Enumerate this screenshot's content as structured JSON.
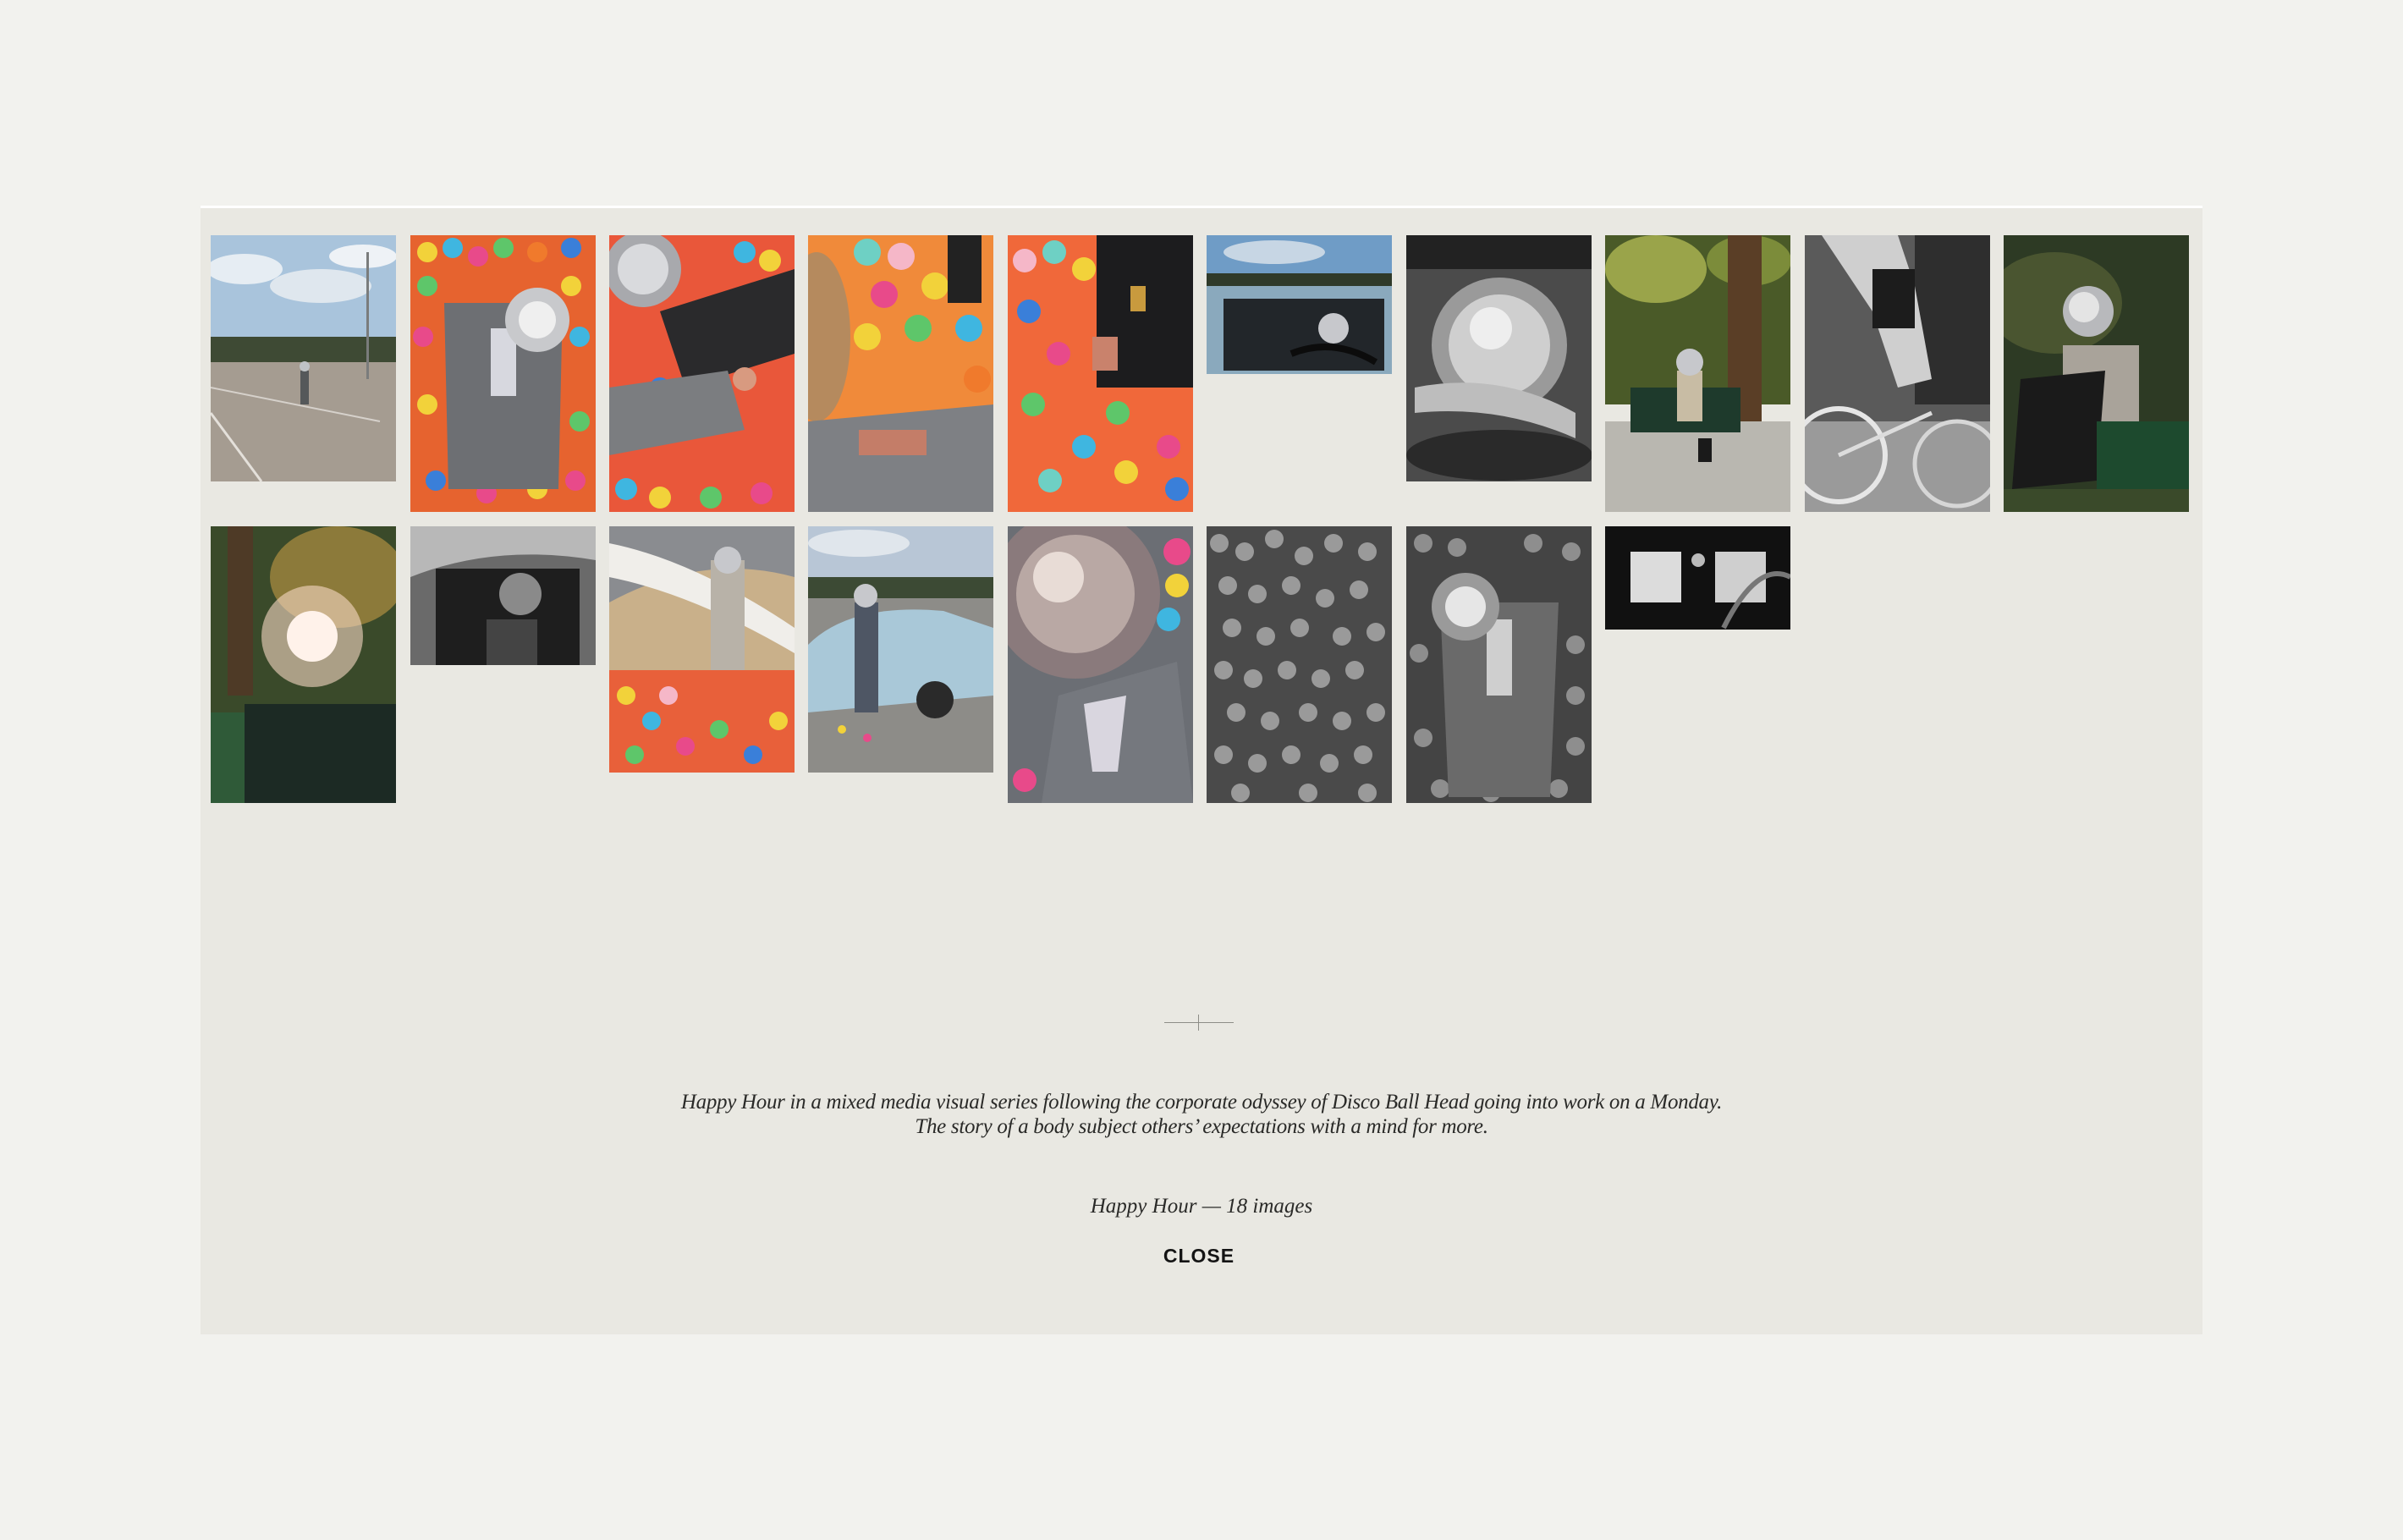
{
  "gallery": {
    "description_line1": "Happy Hour in a mixed media visual series following the corporate odyssey of Disco Ball Head going into work on a Monday.",
    "description_line2": "The story of a body subject others’ expectations with a mind for more.",
    "series_title": "Happy Hour",
    "separator": "—",
    "image_count_label": "18 images",
    "close_label": "CLOSE"
  },
  "colors": {
    "page_background": "#f2f2ee",
    "panel_background": "#e9e8e2",
    "text": "#2a2a28"
  },
  "thumbnails": [
    {
      "name": "thumb-parking-lot",
      "subject": "figure standing alone in empty parking lot"
    },
    {
      "name": "thumb-ball-pit-lying",
      "subject": "disco ball head lying in colorful ball pit"
    },
    {
      "name": "thumb-ball-pit-briefcase",
      "subject": "disco ball head with briefcase in ball pit"
    },
    {
      "name": "thumb-ball-pit-phone",
      "subject": "holding phone in ball pit"
    },
    {
      "name": "thumb-ball-pit-case",
      "subject": "black case in ball pit"
    },
    {
      "name": "thumb-car-driving",
      "subject": "driving car"
    },
    {
      "name": "thumb-bw-steering",
      "subject": "black and white disco ball at steering wheel"
    },
    {
      "name": "thumb-park-bench",
      "subject": "sitting on park bench"
    },
    {
      "name": "thumb-bw-cyclist",
      "subject": "black and white cyclist"
    },
    {
      "name": "thumb-laptop-bench",
      "subject": "laptop on bench"
    },
    {
      "name": "thumb-sun-flare",
      "subject": "sun flare through trees"
    },
    {
      "name": "thumb-bw-car-seat",
      "subject": "black and white car seat"
    },
    {
      "name": "thumb-car-balls",
      "subject": "balls inside car"
    },
    {
      "name": "thumb-car-door",
      "subject": "standing by open car door"
    },
    {
      "name": "thumb-disco-closeup",
      "subject": "disco ball close-up with balls"
    },
    {
      "name": "thumb-bw-balls",
      "subject": "black and white ball pit"
    },
    {
      "name": "thumb-bw-ball-pit-figure",
      "subject": "black and white figure in ball pit"
    },
    {
      "name": "thumb-bw-interior",
      "subject": "black and white car interior"
    }
  ]
}
